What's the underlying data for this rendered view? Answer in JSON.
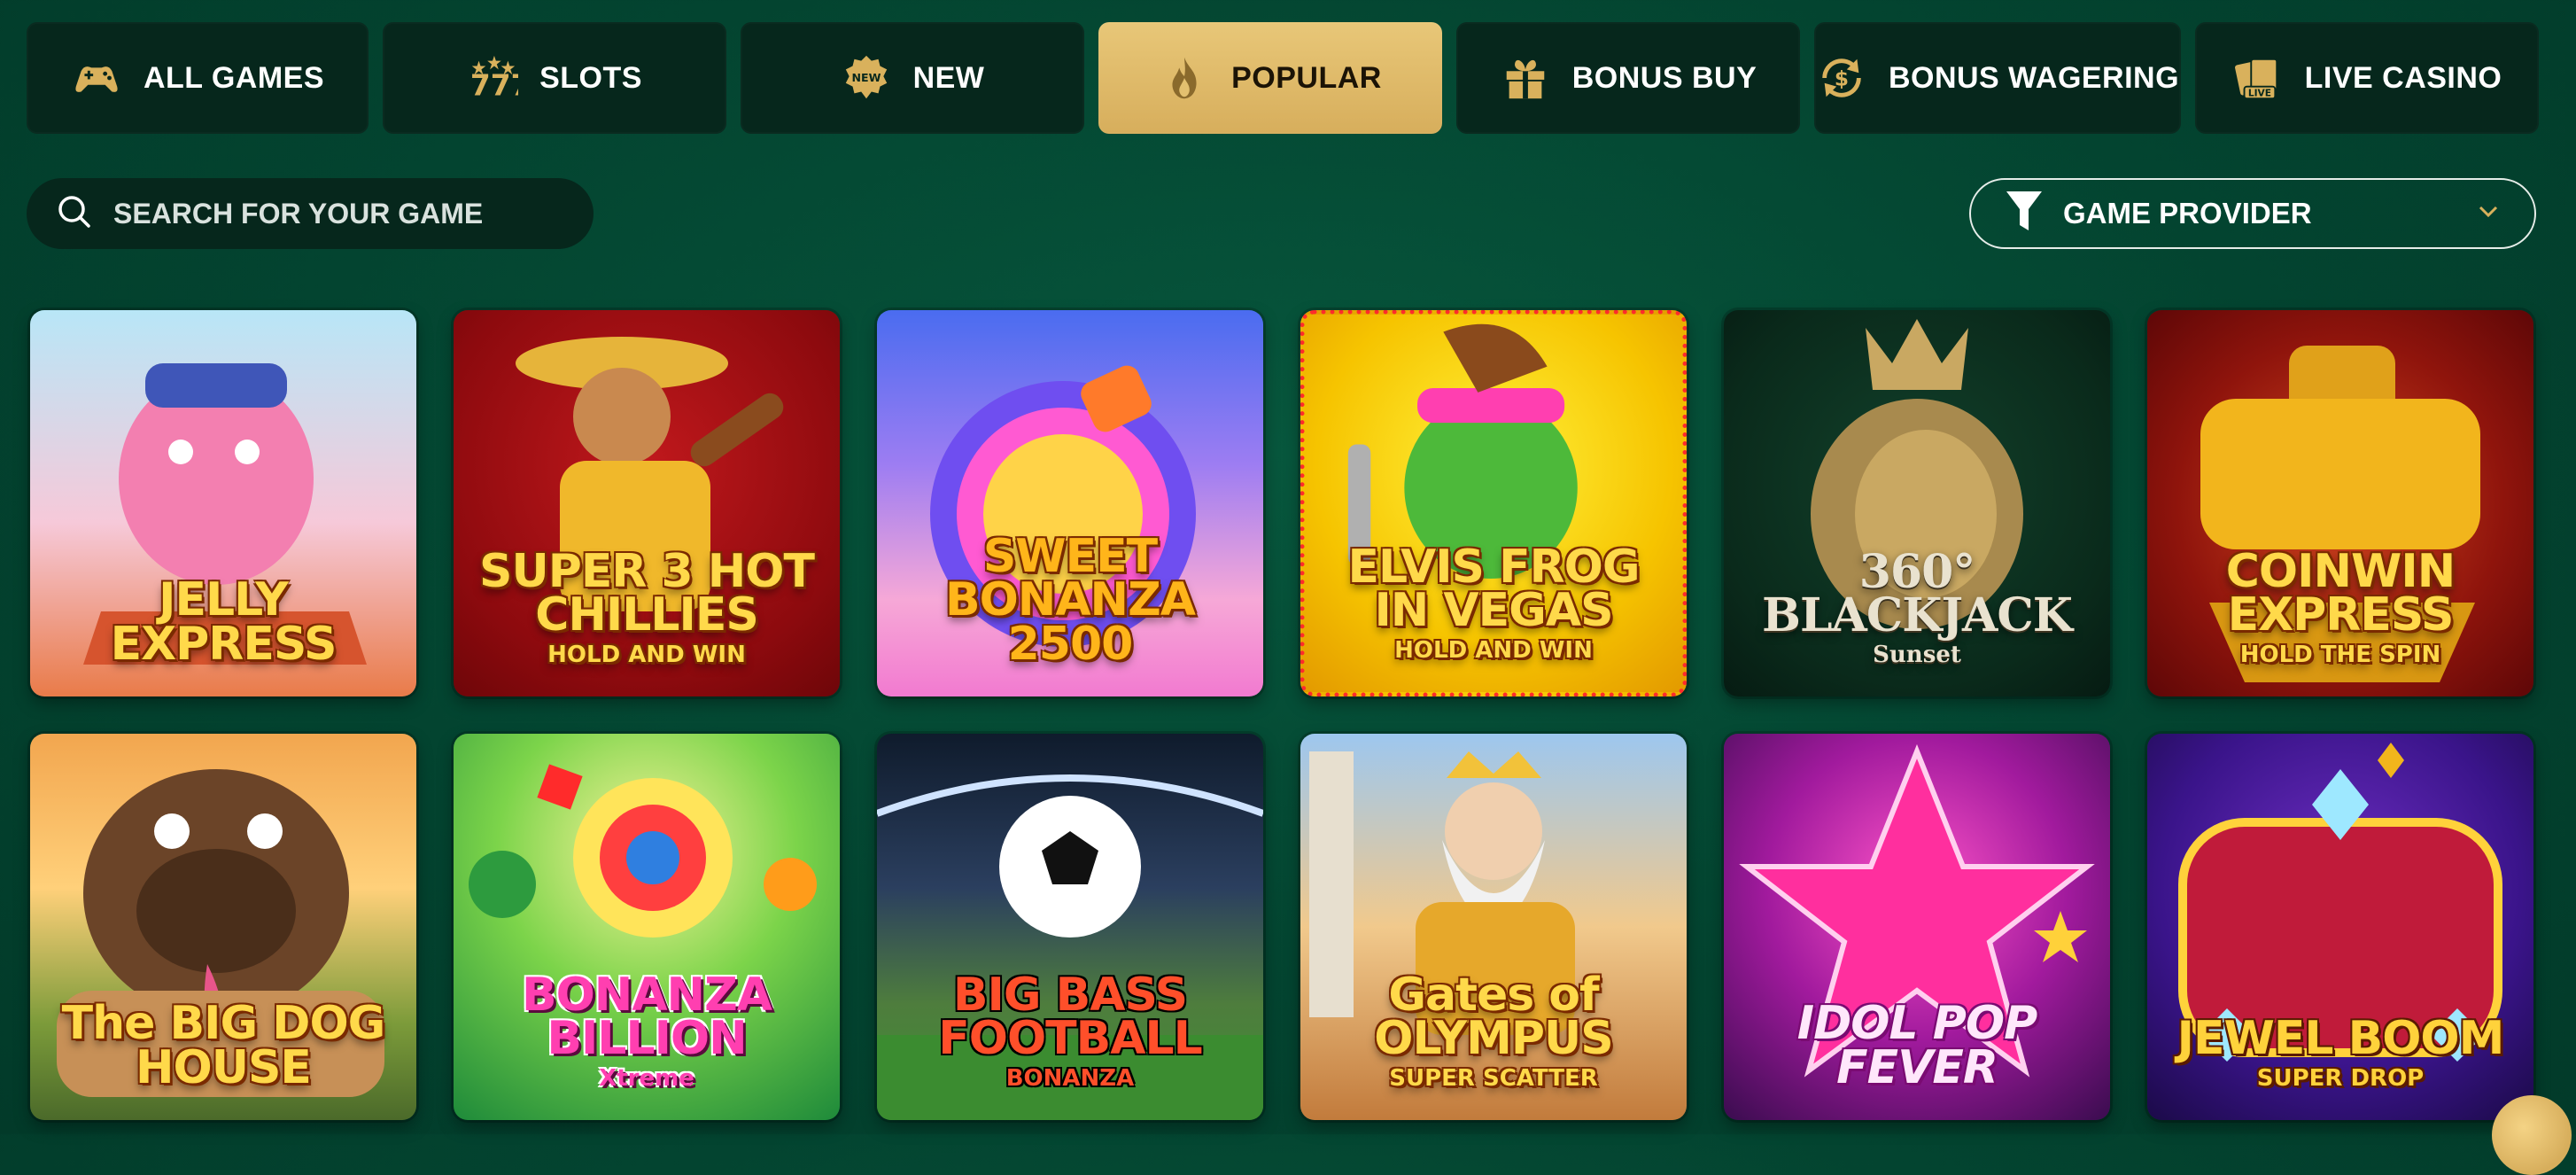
{
  "tabs": [
    {
      "label": "ALL GAMES",
      "icon": "gamepad-icon",
      "active": false
    },
    {
      "label": "SLOTS",
      "icon": "sevens-icon",
      "active": false
    },
    {
      "label": "NEW",
      "icon": "new-badge-icon",
      "active": false
    },
    {
      "label": "POPULAR",
      "icon": "flame-icon",
      "active": true
    },
    {
      "label": "BONUS BUY",
      "icon": "gift-icon",
      "active": false
    },
    {
      "label": "BONUS WAGERING",
      "icon": "dollar-cycle-icon",
      "active": false
    },
    {
      "label": "LIVE CASINO",
      "icon": "live-cards-icon",
      "active": false
    }
  ],
  "search": {
    "placeholder": "SEARCH FOR YOUR GAME",
    "icon": "search-icon"
  },
  "provider": {
    "label": "GAME PROVIDER",
    "icon": "filter-icon",
    "chevron": "chevron-down-icon"
  },
  "games": [
    {
      "title": "JELLY EXPRESS",
      "subtitle": ""
    },
    {
      "title": "SUPER 3 HOT CHILLIES",
      "subtitle": "HOLD AND WIN"
    },
    {
      "title": "SWEET BONANZA 2500",
      "subtitle": ""
    },
    {
      "title": "ELVIS FROG IN VEGAS",
      "subtitle": "HOLD AND WIN"
    },
    {
      "title": "360° BLACKJACK",
      "subtitle": "Sunset"
    },
    {
      "title": "COINWIN EXPRESS",
      "subtitle": "HOLD THE SPIN"
    },
    {
      "title": "The BIG DOG HOUSE",
      "subtitle": ""
    },
    {
      "title": "BONANZA BILLION",
      "subtitle": "Xtreme"
    },
    {
      "title": "BIG BASS FOOTBALL",
      "subtitle": "BONANZA"
    },
    {
      "title": "Gates of OLYMPUS",
      "subtitle": "SUPER SCATTER"
    },
    {
      "title": "IDOL POP FEVER",
      "subtitle": ""
    },
    {
      "title": "JEWEL BOOM",
      "subtitle": "SUPER DROP"
    }
  ],
  "colors": {
    "background": "#034430",
    "tab_bg": "#06271c",
    "accent_gold": "#d7ae5c"
  }
}
